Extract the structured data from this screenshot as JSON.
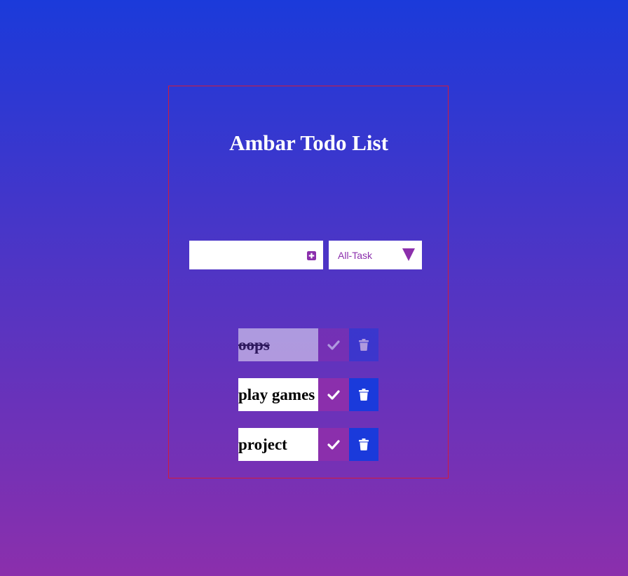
{
  "app": {
    "title": "Ambar Todo List"
  },
  "form": {
    "input_value": "",
    "filter_selected": "All-Task",
    "add_icon": "plus-square-icon",
    "filter_icon": "caret-down-icon"
  },
  "todos": [
    {
      "text": "oops",
      "completed": true
    },
    {
      "text": "play games",
      "completed": false
    },
    {
      "text": "project",
      "completed": false
    }
  ],
  "icons": {
    "complete": "check-icon",
    "delete": "trash-icon"
  },
  "colors": {
    "background_top": "#1b3ada",
    "background_bottom": "#8b2fac",
    "frame_border": "#d01b3c",
    "accent_purple": "#8b2fac",
    "accent_blue": "#1a3adb",
    "title_text": "#ffffff",
    "item_background": "#ffffff"
  }
}
